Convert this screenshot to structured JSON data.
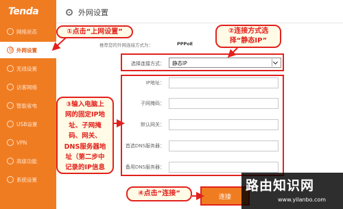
{
  "brand": {
    "logo": "Tenda"
  },
  "sidebar": {
    "items": [
      {
        "label": "网络状态",
        "icon": "network-status-icon"
      },
      {
        "label": "外网设置",
        "icon": "globe-icon",
        "active": true
      },
      {
        "label": "无线设置",
        "icon": "wifi-icon"
      },
      {
        "label": "访客网络",
        "icon": "guest-icon"
      },
      {
        "label": "智能省电",
        "icon": "power-saving-icon"
      },
      {
        "label": "USB设置",
        "icon": "usb-icon"
      },
      {
        "label": "VPN",
        "icon": "vpn-icon"
      },
      {
        "label": "高级功能",
        "icon": "advanced-icon"
      },
      {
        "label": "系统设置",
        "icon": "system-icon"
      }
    ]
  },
  "header": {
    "title": "外网设置"
  },
  "main": {
    "recommend_label": "推荐您的外网连接方式为：",
    "recommend_value": "PPPoE",
    "connection_label": "选择连接方式：",
    "connection_value": "静态IP",
    "fields": [
      {
        "label": "IP地址：",
        "value": ""
      },
      {
        "label": "子网掩码：",
        "value": ""
      },
      {
        "label": "默认网关：",
        "value": ""
      },
      {
        "label": "首选DNS服务器：",
        "value": ""
      },
      {
        "label": "备用DNS服务器：",
        "value": ""
      }
    ],
    "connect_button": "连接"
  },
  "annotations": {
    "step1": "①点击“上网设置”",
    "step2_line1": "②连接方式选",
    "step2_line2": "择“静态IP”",
    "step3_lines": [
      "③输入电脑上",
      "网的固定IP地",
      "址、子网掩",
      "码、网关、",
      "DNS服务器地",
      "址（第二步中",
      "记录的IP信息"
    ],
    "step4": "④点击“连接”"
  },
  "watermark": {
    "title": "路由知识网",
    "url": "www.yilanbo.com"
  },
  "colors": {
    "accent": "#f07c22",
    "annotation_red": "#e2211c",
    "callout_bg": "#fffbe6"
  }
}
